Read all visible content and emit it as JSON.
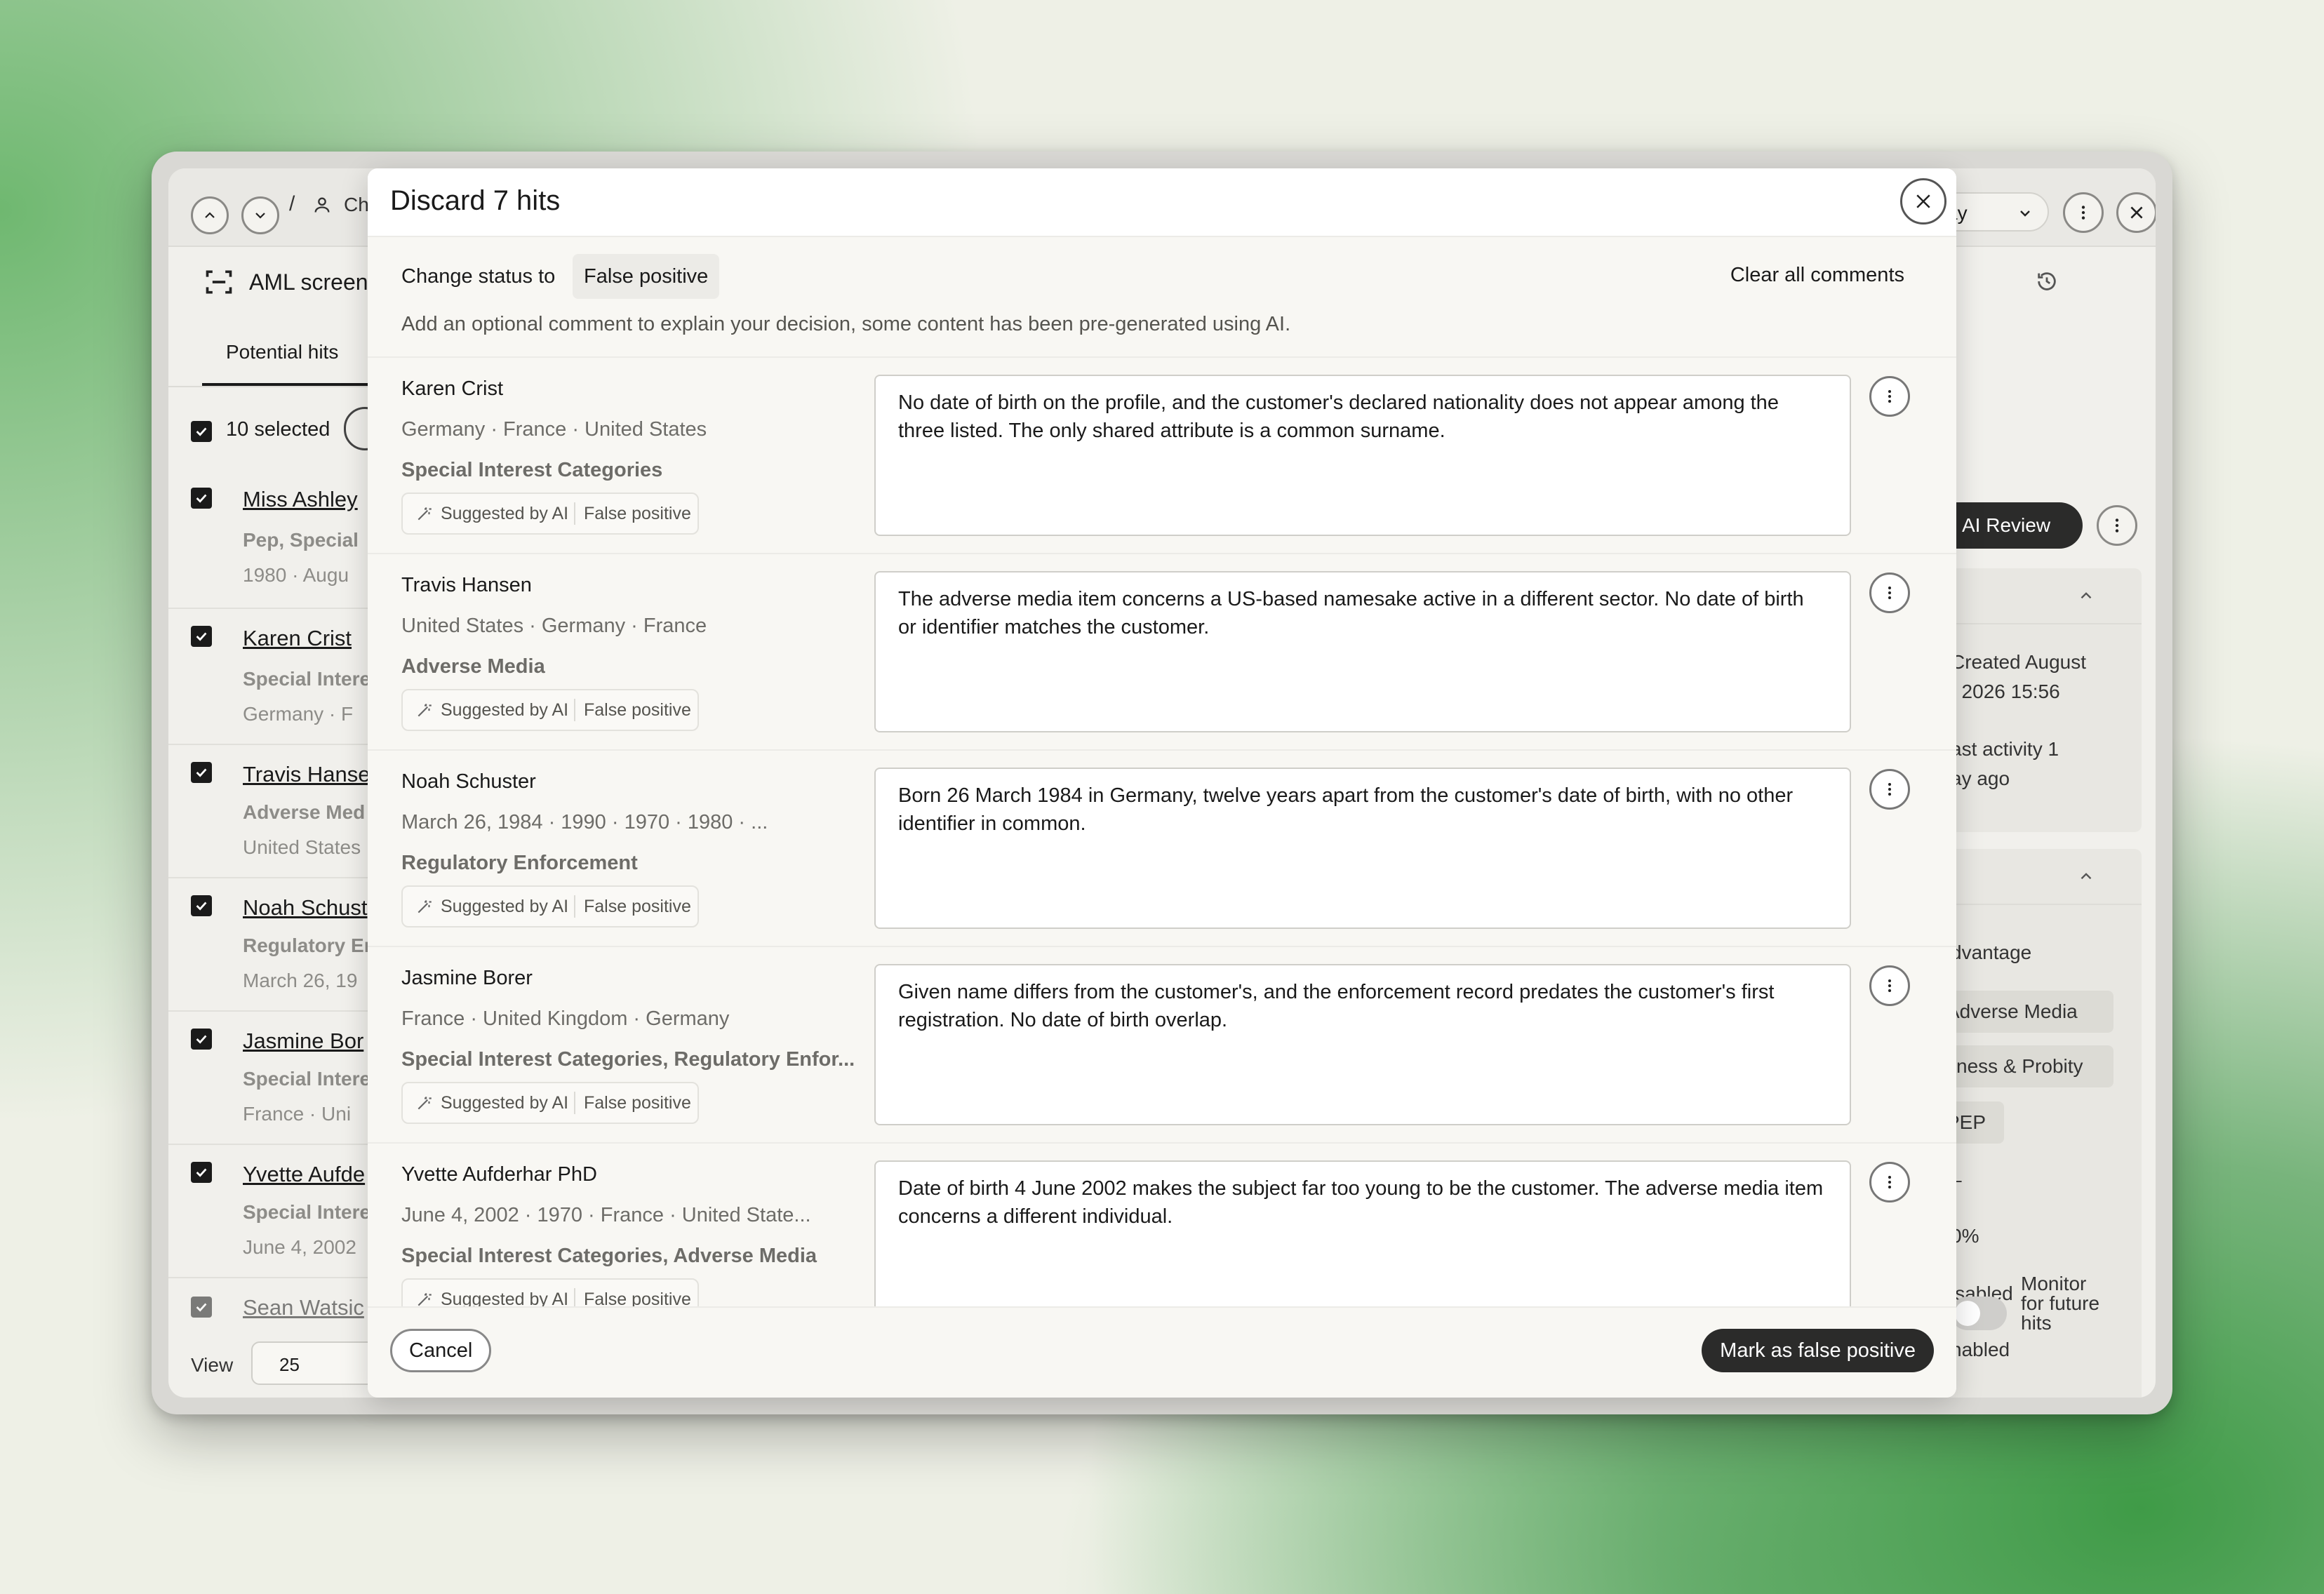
{
  "background": {
    "breadcrumb_partial": "Ch",
    "page_title_partial": "AML screen",
    "tab_label": "Potential hits",
    "selected_label": "10 selected",
    "list": [
      {
        "name": "Miss Ashley",
        "sub": "Pep, Special",
        "meta": "1980  ·  Augu"
      },
      {
        "name": "Karen Crist",
        "sub": "Special Intere",
        "meta": "Germany  ·  F"
      },
      {
        "name": "Travis Hanse",
        "sub": "Adverse Med",
        "meta": "United States"
      },
      {
        "name": "Noah Schust",
        "sub": "Regulatory En",
        "meta": "March 26, 19"
      },
      {
        "name": "Jasmine Bor",
        "sub": "Special Intere",
        "meta": "France  ·  Uni"
      },
      {
        "name": "Yvette Aufde",
        "sub": "Special Intere",
        "meta": "June 4, 2002"
      },
      {
        "name": "Sean Watsic",
        "sub": "",
        "meta": ""
      }
    ],
    "view_label": "View",
    "page_size": "25",
    "right_panel": {
      "dropdown_partial": "ay",
      "ai_review_label": "AI Review",
      "created_text_1": "Created August",
      "created_text_2": ", 2026 15:56",
      "activity_text_1": "ast activity 1",
      "activity_text_2": "ay ago",
      "advantage_text": "dvantage",
      "chips": [
        "Adverse Media",
        "itness & Probity",
        "PEP"
      ],
      "dash": "–",
      "percent": "0%",
      "disabled_text": "isabled",
      "enabled_text": "nabled",
      "monitor_label": "Monitor for future hits"
    }
  },
  "modal": {
    "title": "Discard 7 hits",
    "status_label": "Change status to",
    "status_value": "False positive",
    "clear_comments": "Clear all comments",
    "hint": "Add an optional comment to explain your decision, some content has been pre-generated using AI.",
    "suggested_label": "Suggested by AI",
    "suggested_status": "False positive",
    "hits": [
      {
        "name": "Karen Crist",
        "meta": "Germany  ·  France  ·  United States",
        "categories": "Special Interest Categories",
        "comment": "No date of birth on the profile, and the customer's declared nationality does not appear among the three listed. The only shared attribute is a common surname."
      },
      {
        "name": "Travis Hansen",
        "meta": "United States  ·  Germany  ·  France",
        "categories": "Adverse Media",
        "comment": "The adverse media item concerns a US-based namesake active in a different sector. No date of birth or identifier matches the customer."
      },
      {
        "name": "Noah Schuster",
        "meta": "March 26, 1984  ·  1990  ·  1970  ·  1980  ·  ...",
        "categories": "Regulatory Enforcement",
        "comment": "Born 26 March 1984 in Germany, twelve years apart from the customer's date of birth, with no other identifier in common."
      },
      {
        "name": "Jasmine Borer",
        "meta": "France  ·  United Kingdom  ·  Germany",
        "categories": "Special Interest Categories, Regulatory Enfor...",
        "comment": "Given name differs from the customer's, and the enforcement record predates the customer's first registration. No date of birth overlap."
      },
      {
        "name": "Yvette Aufderhar PhD",
        "meta": "June 4, 2002  ·  1970  ·  France  ·  United State...",
        "categories": "Special Interest Categories, Adverse Media",
        "comment": "Date of birth 4 June 2002 makes the subject far too young to be the customer. The adverse media item concerns a different individual."
      }
    ],
    "cancel_label": "Cancel",
    "confirm_label": "Mark as false positive"
  },
  "icons": [
    "chevron-up-icon",
    "chevron-down-icon",
    "user-icon",
    "scan-icon",
    "checkbox-checked-icon",
    "close-icon",
    "more-vertical-icon",
    "history-icon",
    "magic-wand-icon"
  ]
}
